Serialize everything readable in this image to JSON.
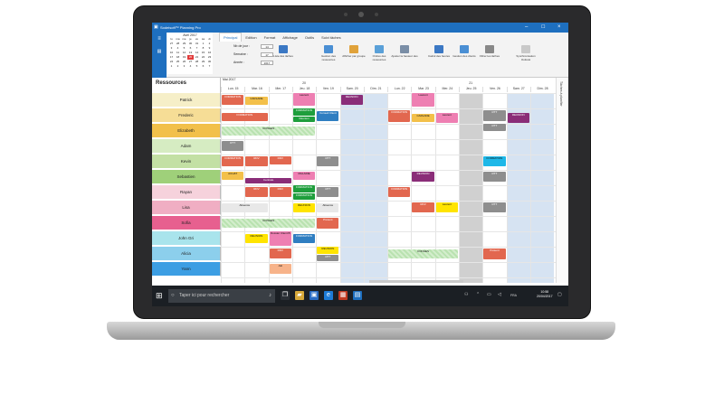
{
  "window": {
    "title": "Sodeisoft™ Planning Pro"
  },
  "ribbon": {
    "tabs": [
      "Principal",
      "Edition",
      "Format",
      "Affichage",
      "Outils",
      "Suivi tâches"
    ],
    "mini_calendar": {
      "month": "Avril 2017",
      "weekdays": [
        "lu",
        "ma",
        "me",
        "je",
        "ve",
        "sa",
        "di"
      ],
      "days": [
        "27",
        "28",
        "29",
        "30",
        "31",
        "1",
        "2",
        "3",
        "4",
        "5",
        "6",
        "7",
        "8",
        "9",
        "10",
        "11",
        "12",
        "13",
        "14",
        "15",
        "16",
        "17",
        "18",
        "19",
        "20",
        "21",
        "22",
        "23",
        "24",
        "25",
        "26",
        "27",
        "28",
        "29",
        "30",
        "1",
        "2",
        "3",
        "4",
        "5",
        "6",
        "7"
      ],
      "today": "20"
    },
    "nav_fields": [
      {
        "label": "Nb de jour :",
        "value": "14"
      },
      {
        "label": "Semaine :",
        "value": "17"
      },
      {
        "label": "Année :",
        "value": "2017"
      }
    ],
    "buttons": [
      {
        "label": "Liste des tâches",
        "color": "#3b78c4"
      },
      {
        "label": "Gestion des ressources",
        "color": "#4a8fd4"
      },
      {
        "label": "Afficher par groupe",
        "color": "#e0a23a"
      },
      {
        "label": "Ordres des ressources",
        "color": "#5aa0d8"
      },
      {
        "label": "Ajuster la hauteur des",
        "color": "#7a8ea6"
      },
      {
        "label": "Calcul des heures",
        "color": "#3b78c4"
      },
      {
        "label": "Gestion des clients",
        "color": "#4a8fd4"
      },
      {
        "label": "Filtrer les tâches",
        "color": "#888888"
      },
      {
        "label": "Synchronisation Outlook",
        "color": "#c9c9c9"
      }
    ]
  },
  "planning": {
    "header_label": "Ressources",
    "month": "Mai 2017",
    "weeks": [
      "20",
      "21"
    ],
    "days": [
      "Lun. 15",
      "Mar. 16",
      "Mer. 17",
      "Jeu. 18",
      "Ven. 19",
      "Sam. 20",
      "Dim. 21",
      "Lun. 22",
      "Mar. 23",
      "Mer. 24",
      "Jeu. 25",
      "Ven. 26",
      "Sam. 27",
      "Dim. 28"
    ],
    "resources": [
      {
        "name": "Patrick",
        "color": "#f6efc8"
      },
      {
        "name": "Frederic",
        "color": "#f6dd96"
      },
      {
        "name": "Elizabeth",
        "color": "#f2c04a"
      },
      {
        "name": "Adam",
        "color": "#d6ecc2"
      },
      {
        "name": "Kevin",
        "color": "#c3e0a4"
      },
      {
        "name": "Sebastien",
        "color": "#9fd07a"
      },
      {
        "name": "Rayan",
        "color": "#f6d2dc"
      },
      {
        "name": "Lisa",
        "color": "#f0aec3"
      },
      {
        "name": "Sofia",
        "color": "#e7608f"
      },
      {
        "name": "John Gri",
        "color": "#a9e4ec"
      },
      {
        "name": "Alicia",
        "color": "#8ccfec"
      },
      {
        "name": "Yann",
        "color": "#3c9ee3"
      }
    ],
    "events": [
      {
        "label": "FORMATION",
        "color": "#e2674f"
      },
      {
        "label": "CARLADE",
        "color": "#f3c04a"
      },
      {
        "label": "Laurent",
        "color": "#ee7fb2"
      },
      {
        "label": "FORMATION",
        "color": "#1e9e3c"
      },
      {
        "label": "REUNION",
        "color": "#8a2d78"
      },
      {
        "label": "FORMATION",
        "color": "#e2674f"
      },
      {
        "label": "Réunion",
        "color": "#1e9e3c"
      },
      {
        "label": "Conseil Client",
        "color": "#2f7ec1"
      },
      {
        "label": "CONGES",
        "color": "#b9e2b0"
      },
      {
        "label": "RTT",
        "color": "#8e8e8e"
      },
      {
        "label": "FORMATION",
        "color": "#e2674f"
      },
      {
        "label": "RDV",
        "color": "#e2674f"
      },
      {
        "label": "RDV",
        "color": "#e2674f"
      },
      {
        "label": "RTT",
        "color": "#8e8e8e"
      },
      {
        "label": "ACHAT",
        "color": "#f3c04a"
      },
      {
        "label": "MALADIE",
        "color": "#ee7fb2"
      },
      {
        "label": "FORMATION",
        "color": "#1e9e3c"
      },
      {
        "label": "Centrale",
        "color": "#8a2d78"
      },
      {
        "label": "RDV",
        "color": "#e2674f"
      },
      {
        "label": "RDV",
        "color": "#e2674f"
      },
      {
        "label": "FORMATION",
        "color": "#1e9e3c"
      },
      {
        "label": "RTT",
        "color": "#8e8e8e"
      },
      {
        "label": "Absence",
        "color": "#e8e8e8"
      },
      {
        "label": "REUNION",
        "color": "#ffe400"
      },
      {
        "label": "Absence",
        "color": "#e8e8e8"
      },
      {
        "label": "CONGES",
        "color": "#b9e2b0"
      },
      {
        "label": "Présent",
        "color": "#e2674f"
      },
      {
        "label": "REUNION",
        "color": "#ffe400"
      },
      {
        "label": "Dossier Client B",
        "color": "#ee7fb2"
      },
      {
        "label": "FORMATION",
        "color": "#2f7ec1"
      },
      {
        "label": "RDV",
        "color": "#e2674f"
      },
      {
        "label": "REUNION",
        "color": "#ffe400"
      },
      {
        "label": "CONGES",
        "color": "#b9e2b0"
      },
      {
        "label": "RTT",
        "color": "#8e8e8e"
      },
      {
        "label": "Job",
        "color": "#f7b38a"
      },
      {
        "label": "Laurent",
        "color": "#ee7fb2"
      },
      {
        "label": "Laurent",
        "color": "#ee7fb2"
      },
      {
        "label": "RTT",
        "color": "#8e8e8e"
      },
      {
        "label": "REUNION",
        "color": "#8a2d78"
      },
      {
        "label": "FORMATION",
        "color": "#e2674f"
      },
      {
        "label": "CARLADE",
        "color": "#f3c04a"
      },
      {
        "label": "RTT",
        "color": "#8e8e8e"
      },
      {
        "label": "FORMATION",
        "color": "#1eb8e8"
      },
      {
        "label": "REUNION",
        "color": "#8a2d78"
      },
      {
        "label": "RTT",
        "color": "#8e8e8e"
      },
      {
        "label": "FORMATION",
        "color": "#e2674f"
      },
      {
        "label": "RDV",
        "color": "#e2674f"
      },
      {
        "label": "Laurent",
        "color": "#ffe400"
      },
      {
        "label": "RTT",
        "color": "#8e8e8e"
      },
      {
        "label": "CONGES",
        "color": "#b9e2b0"
      },
      {
        "label": "Présent",
        "color": "#e2674f"
      }
    ],
    "side_panel_label": "Tâches à planifier"
  },
  "taskbar": {
    "search_placeholder": "Taper ici pour rechercher",
    "language": "FRA",
    "time": "10:58",
    "date": "20/04/2017"
  }
}
